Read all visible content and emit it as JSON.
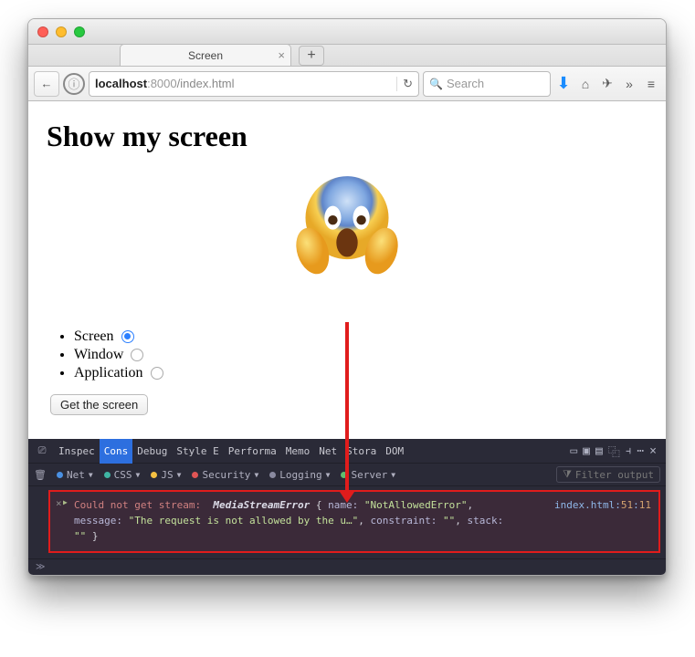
{
  "tab": {
    "title": "Screen",
    "new": "+"
  },
  "url": {
    "host": "localhost",
    "port": ":8000",
    "path": "/index.html"
  },
  "search": {
    "placeholder": "Search"
  },
  "page": {
    "heading": "Show my screen",
    "options": [
      {
        "label": "Screen",
        "checked": true
      },
      {
        "label": "Window",
        "checked": false
      },
      {
        "label": "Application",
        "checked": false
      }
    ],
    "button": "Get the screen"
  },
  "devtools": {
    "tabs": [
      "Inspec",
      "Cons",
      "Debug",
      "Style E",
      "Performa",
      "Memo",
      "Net",
      "Stora",
      "DOM"
    ],
    "active": 1,
    "filters": [
      {
        "label": "Net",
        "color": "#4a90e2"
      },
      {
        "label": "CSS",
        "color": "#3fb5a3"
      },
      {
        "label": "JS",
        "color": "#f5c042"
      },
      {
        "label": "Security",
        "color": "#e05555"
      },
      {
        "label": "Logging",
        "color": "#8a8aa0"
      },
      {
        "label": "Server",
        "color": "#5fbf6f"
      }
    ],
    "filter_placeholder": "Filter output",
    "error": {
      "prefix": "Could not get stream:",
      "class": "MediaStreamError",
      "body": "{ name: \"NotAllowedError\", message: \"The request is not allowed by the u…\", constraint: \"\", stack: \"\" }",
      "file": "index.html",
      "line": "51",
      "col": "11"
    },
    "prompt": "≫"
  }
}
